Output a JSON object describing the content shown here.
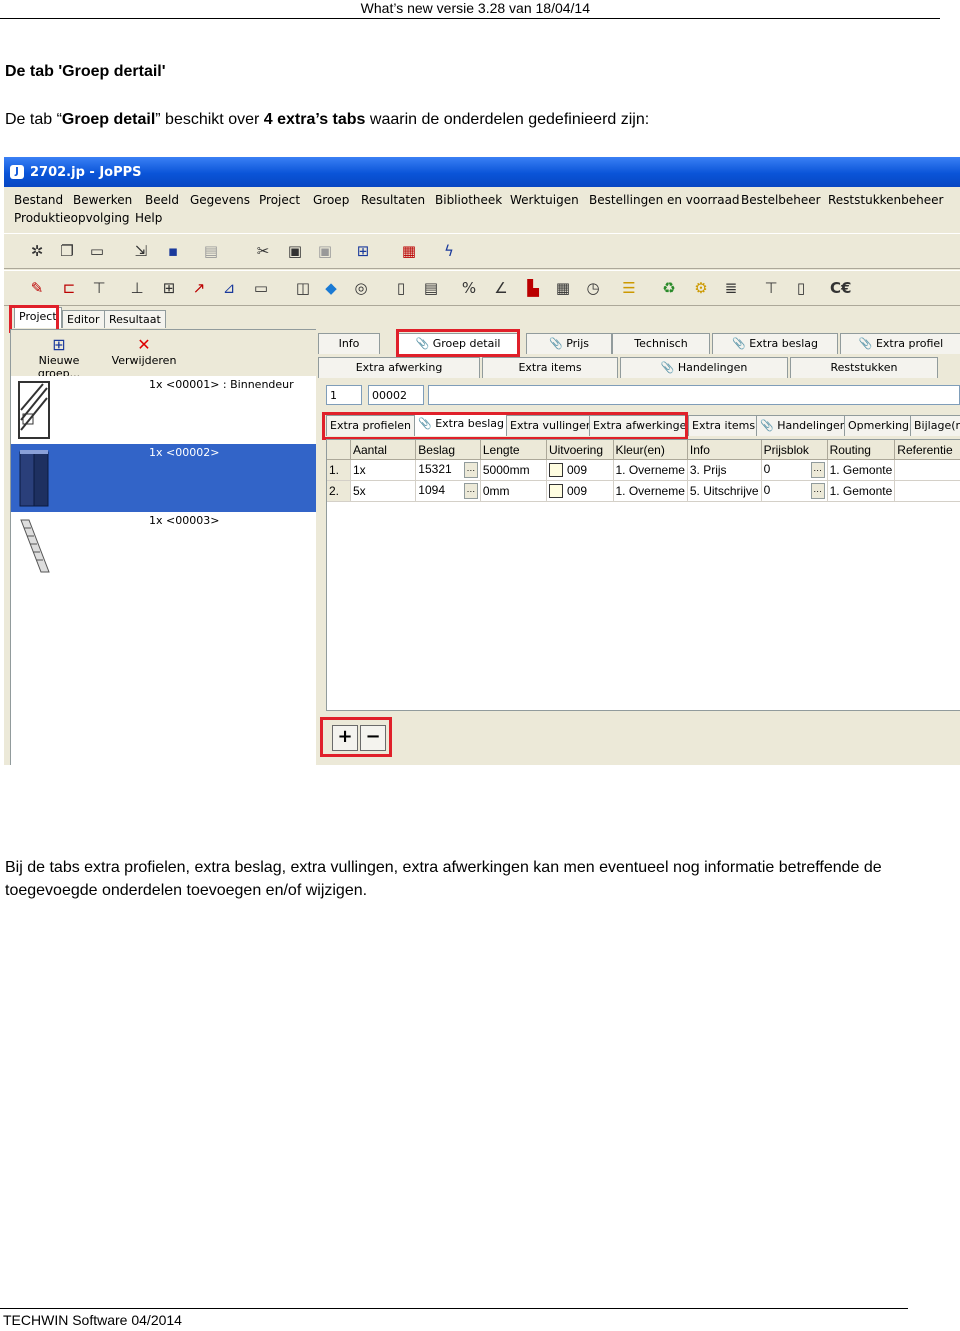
{
  "header": {
    "text": "What’s new versie 3.28 van 18/04/14"
  },
  "heading": "De tab 'Groep dertail'",
  "intro": {
    "part1": "De tab “",
    "bold1": "Groep detail",
    "part2": "” beschikt over ",
    "bold2": "4 extra’s tabs",
    "part3": " waarin de onderdelen gedefinieerd zijn:"
  },
  "app": {
    "title": "2702.jp - JoPPS",
    "menu": [
      "Bestand",
      "Bewerken",
      "Beeld",
      "Gegevens",
      "Project",
      "Groep",
      "Resultaten",
      "Bibliotheek",
      "Werktuigen",
      "Bestellingen en voorraad",
      "Bestelbeheer",
      "Reststukkenbeheer",
      "Produktieopvolging",
      "Help"
    ],
    "side_tabs": [
      "Project",
      "Editor",
      "Resultaat"
    ],
    "left_buttons": {
      "new_group": "Nieuwe groep...",
      "delete": "Verwijderen"
    },
    "groups": [
      "1x <00001> : Binnendeur",
      "1x <00002>",
      "1x <00003>"
    ],
    "tabs_row1": [
      "Info",
      "Groep detail",
      "Prijs",
      "Technisch",
      "Extra beslag",
      "Extra profiel"
    ],
    "tabs_row2": [
      "Extra afwerking",
      "Extra items",
      "Handelingen",
      "Reststukken"
    ],
    "fields": {
      "count": "1",
      "code": "00002"
    },
    "sub_tabs": [
      "Extra profielen",
      "Extra beslag",
      "Extra vullingen",
      "Extra afwerkingen",
      "Extra items",
      "Handelingen",
      "Opmerking",
      "Bijlage(n)"
    ],
    "grid": {
      "columns": [
        "",
        "Aantal",
        "Beslag",
        "Lengte",
        "Uitvoering",
        "Kleur(en)",
        "Info",
        "Prijsblok",
        "Routing",
        "Referentie"
      ],
      "rows": [
        [
          "1.",
          "1x",
          "15321",
          "5000mm",
          "009",
          "1. Overneme",
          "3. Prijs",
          "0",
          "1. Gemonte"
        ],
        [
          "2.",
          "5x",
          "1094",
          "0mm",
          "009",
          "1. Overneme",
          "5. Uitschrijve",
          "0",
          "1. Gemonte"
        ]
      ]
    },
    "plus": "+",
    "minus": "−"
  },
  "paragraph": "Bij de tabs extra profielen, extra beslag, extra vullingen, extra afwerkingen kan men eventueel nog informatie betreffende de toegevoegde onderdelen toevoegen en/of wijzigen.",
  "footer": "TECHWIN Software 04/2014",
  "colors": {
    "highlight": "#e0202a",
    "selection": "#3264c8",
    "titlebar": "#0a54d8"
  }
}
